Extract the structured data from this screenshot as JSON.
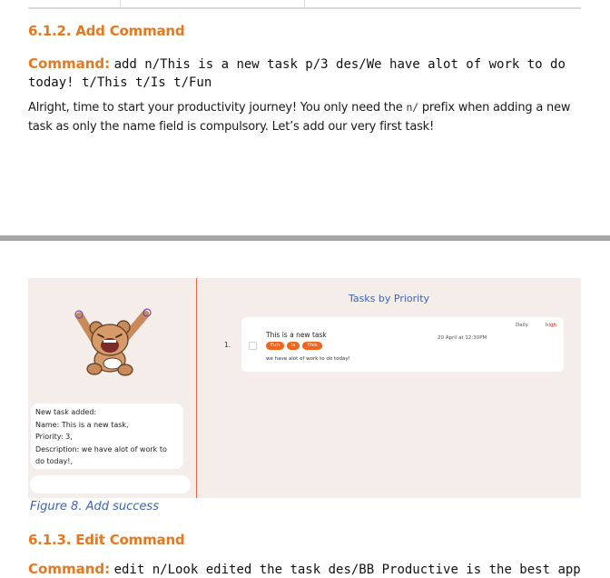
{
  "section_612": {
    "heading": "6.1.2. Add Command",
    "command_label": "Command:",
    "command_line1": "add n/This is a new task p/3 des/We have alot of work to do",
    "command_line2": "today! t/This t/Is t/Fun",
    "para_line1_before": "Alright, time to start your productivity journey! You only need the",
    "para_code": "n/",
    "para_line1_after": "prefix when adding a new",
    "para_line2": "task as only the name field is compulsory. Let’s add our very first task!"
  },
  "figure": {
    "title": "Tasks by Priority",
    "bubble_lines": [
      "New task added:",
      "Name: This is a new task,",
      "Priority: 3,",
      "Description: we have alot of work to",
      "do today!,"
    ],
    "task": {
      "index": "1.",
      "name": "This is a new task",
      "tags": [
        "Fun",
        "Is",
        "This"
      ],
      "description": "we have alot of work to do today!",
      "date": "20 April at 12:30PM",
      "recurrence": "Daily",
      "priority": "high"
    },
    "caption": "Figure 8. Add success"
  },
  "section_613": {
    "heading": "6.1.3. Edit Command",
    "command_label": "Command:",
    "command_text": "edit n/Look edited the task des/BB Productive is the best app"
  },
  "colors": {
    "heading_orange": "#e8781e",
    "caption_blue": "#3f63b5",
    "tag_orange": "#f0651e",
    "priority_red": "#e2261d"
  }
}
